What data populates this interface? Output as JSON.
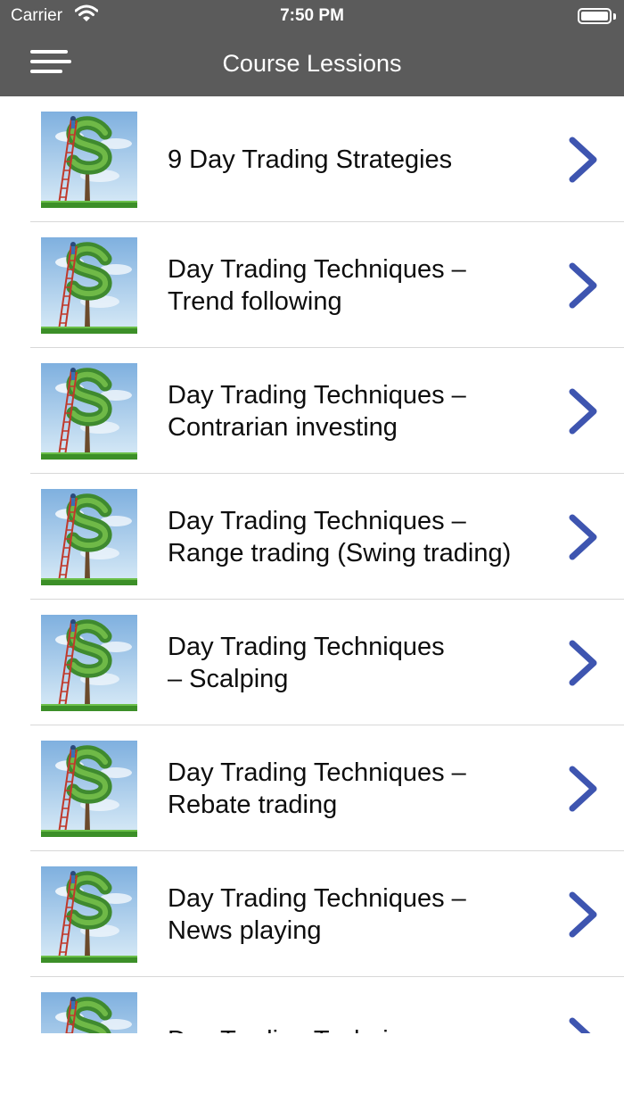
{
  "status_bar": {
    "carrier": "Carrier",
    "time": "7:50 PM"
  },
  "nav": {
    "title": "Course Lessions",
    "menu_icon": "hamburger-menu-icon"
  },
  "theme": {
    "bar_color": "#5b5b5b",
    "chevron_color": "#3e55b0",
    "separator_color": "#d8d8d8"
  },
  "lessons": [
    {
      "title": "9 Day Trading Strategies",
      "thumbnail": "money-tree-icon"
    },
    {
      "title": "Day Trading Techniques –\nTrend following",
      "thumbnail": "money-tree-icon"
    },
    {
      "title": "Day Trading Techniques –\nContrarian investing",
      "thumbnail": "money-tree-icon"
    },
    {
      "title": "Day Trading Techniques –\nRange trading (Swing trading)",
      "thumbnail": "money-tree-icon"
    },
    {
      "title": "Day Trading Techniques\n– Scalping",
      "thumbnail": "money-tree-icon"
    },
    {
      "title": "Day Trading Techniques –\nRebate trading",
      "thumbnail": "money-tree-icon"
    },
    {
      "title": "Day Trading Techniques –\nNews playing",
      "thumbnail": "money-tree-icon"
    },
    {
      "title": "Day Trading Techniques –",
      "thumbnail": "money-tree-icon"
    }
  ]
}
